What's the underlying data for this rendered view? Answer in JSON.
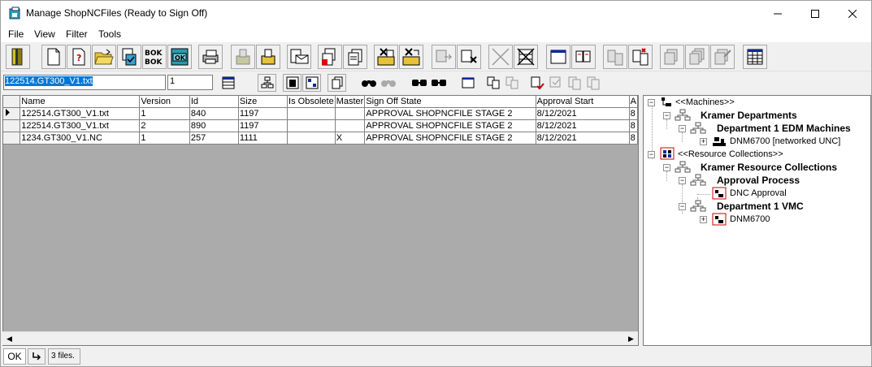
{
  "window": {
    "title": "Manage ShopNCFiles (Ready to Sign Off)",
    "icon": "app-window-icon",
    "controls": [
      "minimize-icon",
      "maximize-icon",
      "close-icon"
    ]
  },
  "menu": [
    {
      "label": "File"
    },
    {
      "label": "View"
    },
    {
      "label": "Filter"
    },
    {
      "label": "Tools"
    }
  ],
  "toolbar_primary": [
    "exit-door-icon",
    "new-document-icon",
    "help-document-icon",
    "open-folder-icon",
    "checklist-icon",
    "ok-all-icon",
    "ok-single-icon",
    "printer-icon",
    "import-icon",
    "export-icon",
    "send-mail-icon",
    "add-document-icon",
    "copy-documents-icon",
    "delete-to-folder-icon",
    "move-to-folder-icon",
    "transfer-icon",
    "cancel-transfer-icon",
    "cancel-icon",
    "grid-off-icon",
    "window-icon",
    "book-icon",
    "compare-icon",
    "compare-red-icon",
    "clone-icon",
    "clone-multiple-icon",
    "clone-edit-icon",
    "calendar-table-icon"
  ],
  "filter_bar": {
    "file_name": "122514.GT300_V1.txt",
    "version": "1"
  },
  "grid": {
    "columns": [
      "Name",
      "Version",
      "Id",
      "Size",
      "Is Obsolete",
      "Master",
      "Sign Off State",
      "Approval Start",
      "A"
    ],
    "rows": [
      {
        "selected": true,
        "cells": [
          "122514.GT300_V1.txt",
          "1",
          "840",
          "1197",
          "",
          "",
          "APPROVAL SHOPNCFILE STAGE 2",
          "8/12/2021",
          "8"
        ]
      },
      {
        "selected": false,
        "cells": [
          "122514.GT300_V1.txt",
          "2",
          "890",
          "1197",
          "",
          "",
          "APPROVAL SHOPNCFILE STAGE 2",
          "8/12/2021",
          "8"
        ]
      },
      {
        "selected": false,
        "cells": [
          "1234.GT300_V1.NC",
          "1",
          "257",
          "1111",
          "",
          "X",
          "APPROVAL SHOPNCFILE STAGE 2",
          "8/12/2021",
          "8"
        ]
      }
    ]
  },
  "tree": {
    "machines_root": "<<Machines>>",
    "kramer_departments": "Kramer Departments",
    "dept1_edm": "Department 1 EDM Machines",
    "dnm_networked": "DNM6700 [networked UNC]",
    "resources_root": "<<Resource Collections>>",
    "kramer_resources": "Kramer Resource Collections",
    "approval_process": "Approval Process",
    "dnc_approval": "DNC Approval",
    "dept1_vmc": "Department 1 VMC",
    "dnm6700": "DNM6700"
  },
  "status": {
    "ok": "OK",
    "count": "3 files."
  }
}
